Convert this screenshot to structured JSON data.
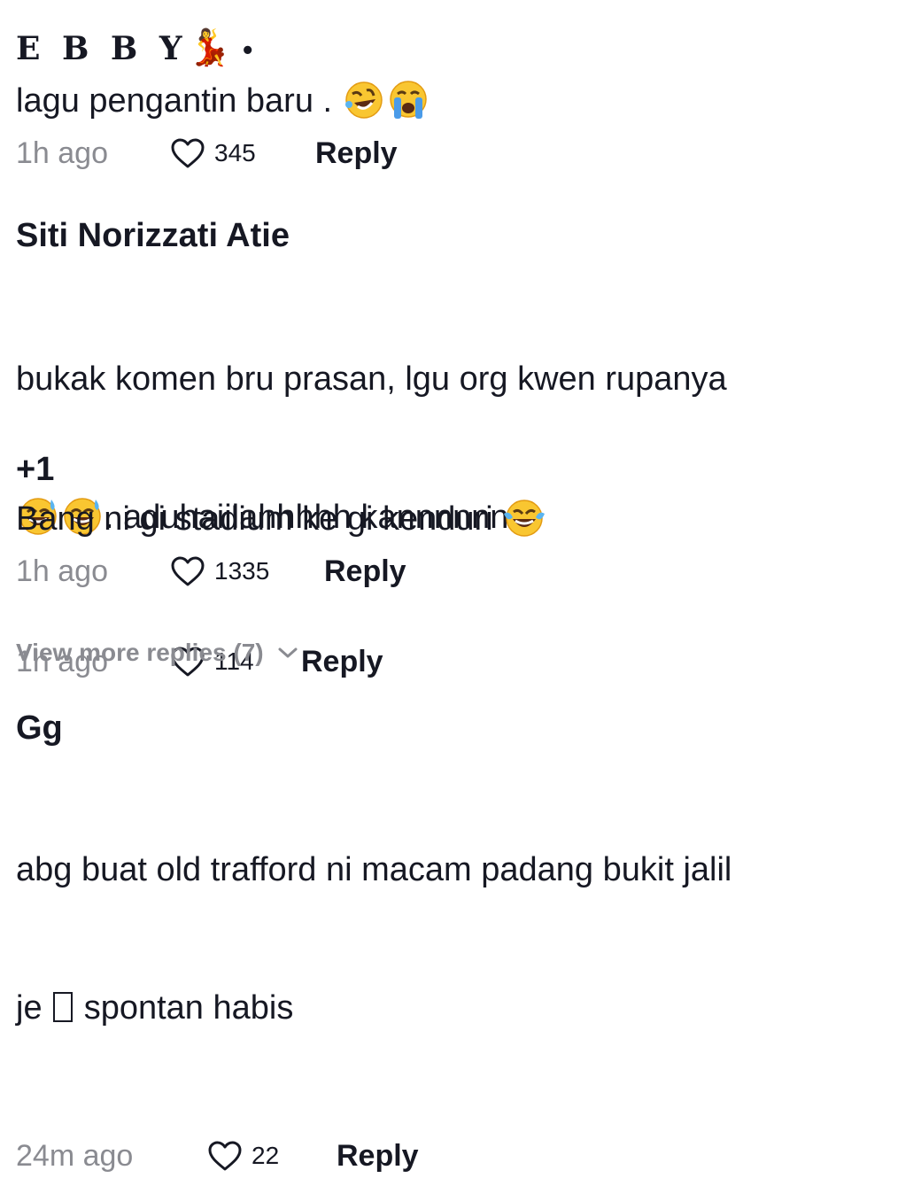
{
  "comments": [
    {
      "username": "E B B Y",
      "username_suffix": "•",
      "text": "lagu pengantin baru . ",
      "emojis": [
        "rofl-emoji",
        "crying-emoji"
      ],
      "time": "1h ago",
      "likes": "345",
      "reply_label": "Reply"
    },
    {
      "username": "Siti Norizzati Atie",
      "text_line1": "bukak komen bru prasan, lgu org kwen rupanya",
      "text_line2": ". aduhaiilahhhhh kannnnnn",
      "emojis": [
        "sweat-smile-emoji",
        "sweat-smile-emoji"
      ],
      "time": "1h ago",
      "likes": "114",
      "reply_label": "Reply"
    },
    {
      "username": "+1",
      "text": "Bang ni gi stadium ke gi kenduri ",
      "emojis": [
        "joy-emoji"
      ],
      "time": "1h ago",
      "likes": "1335",
      "reply_label": "Reply"
    },
    {
      "username": "Gg",
      "text_line1": "abg buat old trafford ni macam padang bukit jalil",
      "text_line2a": "je ",
      "text_line2b": " spontan habis",
      "time": "24m ago",
      "likes": "22",
      "reply_label": "Reply"
    }
  ],
  "view_more": {
    "label": "View more replies (7)"
  }
}
